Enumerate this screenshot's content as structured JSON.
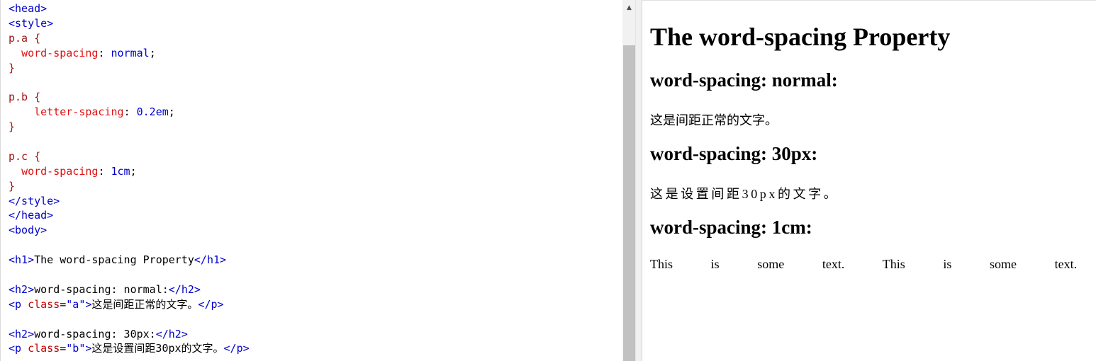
{
  "editor": {
    "lines": [
      [
        [
          "tag",
          "<head>"
        ]
      ],
      [
        [
          "tag",
          "<style>"
        ]
      ],
      [
        [
          "sel",
          "p.a {"
        ]
      ],
      [
        [
          "plain",
          "  "
        ],
        [
          "prop",
          "word-spacing"
        ],
        [
          "plain",
          ": "
        ],
        [
          "cssv",
          "normal"
        ],
        [
          "plain",
          ";"
        ]
      ],
      [
        [
          "sel",
          "}"
        ]
      ],
      [],
      [
        [
          "sel",
          "p.b {"
        ]
      ],
      [
        [
          "plain",
          "    "
        ],
        [
          "prop",
          "letter-spacing"
        ],
        [
          "plain",
          ": "
        ],
        [
          "cssv",
          "0.2em"
        ],
        [
          "plain",
          ";"
        ]
      ],
      [
        [
          "sel",
          "}"
        ]
      ],
      [],
      [
        [
          "sel",
          "p.c {"
        ]
      ],
      [
        [
          "plain",
          "  "
        ],
        [
          "prop",
          "word-spacing"
        ],
        [
          "plain",
          ": "
        ],
        [
          "cssv",
          "1cm"
        ],
        [
          "plain",
          ";"
        ]
      ],
      [
        [
          "sel",
          "}"
        ]
      ],
      [
        [
          "tag",
          "</style>"
        ]
      ],
      [
        [
          "tag",
          "</head>"
        ]
      ],
      [
        [
          "tag",
          "<body>"
        ]
      ],
      [],
      [
        [
          "tag",
          "<h1>"
        ],
        [
          "plain",
          "The word-spacing Property"
        ],
        [
          "tag",
          "</h1>"
        ]
      ],
      [],
      [
        [
          "tag",
          "<h2>"
        ],
        [
          "plain",
          "word-spacing: normal:"
        ],
        [
          "tag",
          "</h2>"
        ]
      ],
      [
        [
          "tag",
          "<p "
        ],
        [
          "attr",
          "class"
        ],
        [
          "plain",
          "="
        ],
        [
          "val",
          "\"a\""
        ],
        [
          "tag",
          ">"
        ],
        [
          "plain",
          "这是间距正常的文字。"
        ],
        [
          "tag",
          "</p>"
        ]
      ],
      [],
      [
        [
          "tag",
          "<h2>"
        ],
        [
          "plain",
          "word-spacing: 30px:"
        ],
        [
          "tag",
          "</h2>"
        ]
      ],
      [
        [
          "tag",
          "<p "
        ],
        [
          "attr",
          "class"
        ],
        [
          "plain",
          "="
        ],
        [
          "val",
          "\"b\""
        ],
        [
          "tag",
          ">"
        ],
        [
          "plain",
          "这是设置间距30px的文字。"
        ],
        [
          "tag",
          "</p>"
        ]
      ]
    ]
  },
  "result": {
    "h1": "The word-spacing Property",
    "h2_normal": "word-spacing: normal:",
    "p_a": "这是间距正常的文字。",
    "h2_30px": "word-spacing: 30px:",
    "p_b": "这是设置间距30px的文字。",
    "h2_1cm": "word-spacing: 1cm:",
    "p_c": "This is some text. This is some text."
  },
  "icons": {
    "scroll_up": "▲"
  },
  "colors": {
    "tag": "#0000cd",
    "attr": "#c00000",
    "selector": "#a31515",
    "property": "#e01010",
    "value": "#0000cd"
  }
}
